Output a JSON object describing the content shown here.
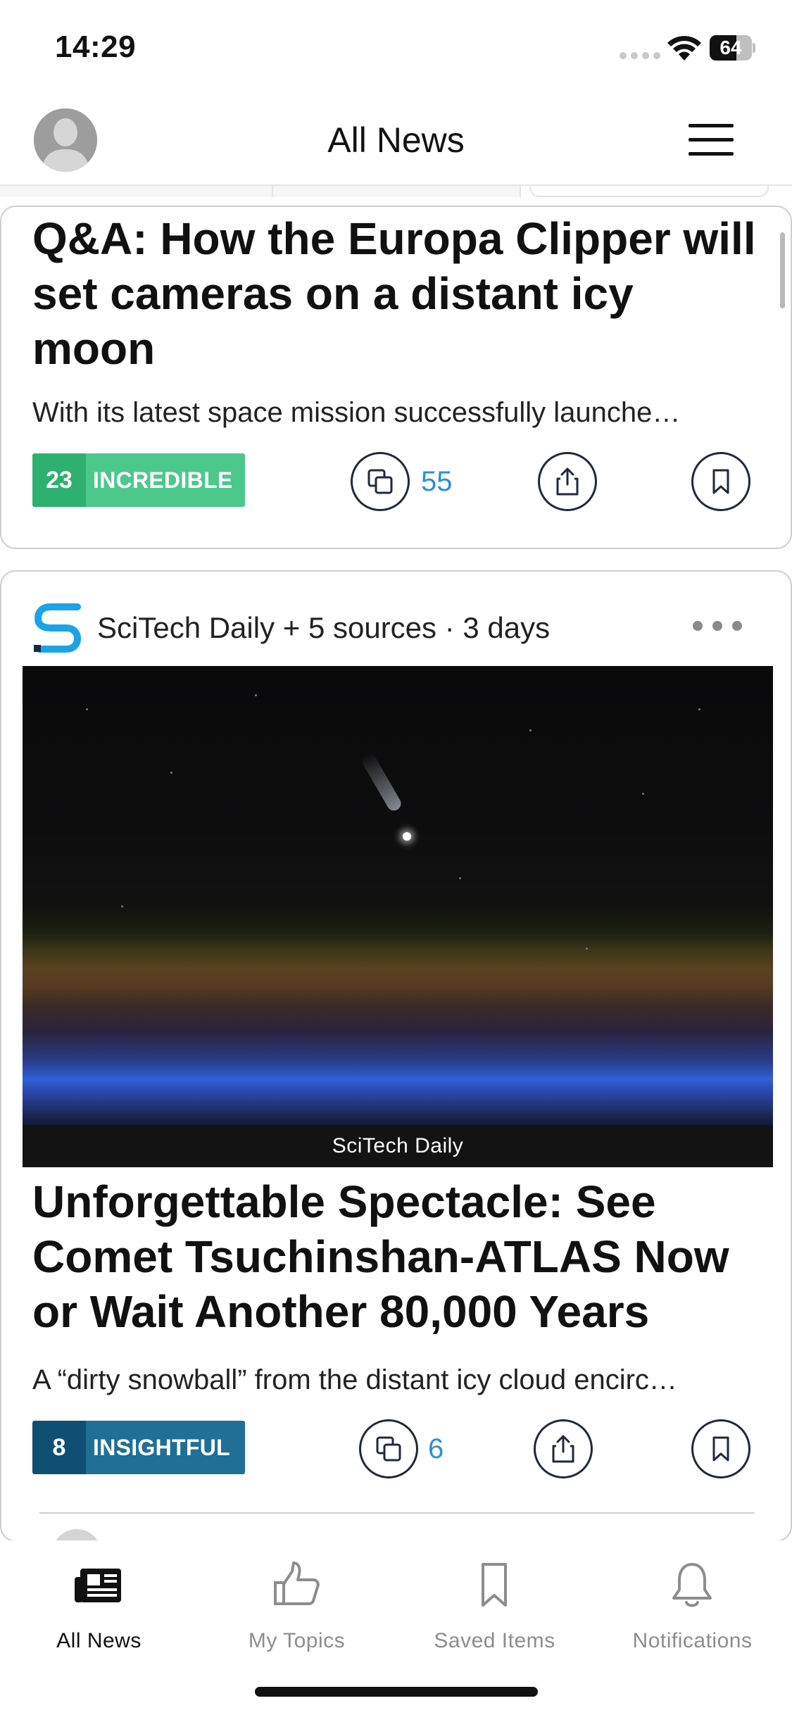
{
  "status_bar": {
    "time": "14:29",
    "battery_level": "64",
    "battery_fraction": 0.64,
    "icons": [
      "signal-dots-icon",
      "wifi-icon",
      "battery-icon"
    ]
  },
  "header": {
    "title": "All News",
    "avatar_icon": "profile-avatar-icon",
    "menu_icon": "hamburger-menu-icon"
  },
  "articles": [
    {
      "headline": "Q&A: How the Europa Clipper will set cameras on a distant icy moon",
      "summary": "With its latest space mission successfully launche…",
      "badge_count": "23",
      "badge_label": "INCREDIBLE",
      "badge_colors": {
        "count_bg": "#2eb06f",
        "label_bg": "#4cc88b"
      },
      "related_count": "55"
    },
    {
      "source": "SciTech Daily + 5 sources · 3 days",
      "source_logo_icon": "scitech-daily-logo-icon",
      "image_caption": "SciTech Daily",
      "headline": "Unforgettable Spectacle: See Comet Tsuchinshan-ATLAS Now or Wait Another 80,000 Years",
      "summary": "A “dirty snowball” from the distant icy cloud encirc…",
      "badge_count": "8",
      "badge_label": "INSIGHTFUL",
      "badge_colors": {
        "count_bg": "#0f4f74",
        "label_bg": "#1f6f97"
      },
      "related_count": "6"
    }
  ],
  "bottom_nav": [
    {
      "label": "All News",
      "icon": "newspaper-icon",
      "active": true
    },
    {
      "label": "My Topics",
      "icon": "thumbs-up-icon",
      "active": false
    },
    {
      "label": "Saved Items",
      "icon": "bookmark-icon",
      "active": false
    },
    {
      "label": "Notifications",
      "icon": "bell-icon",
      "active": false
    }
  ],
  "colors": {
    "link_count": "#2e8fd6",
    "nav_active": "#111111",
    "nav_inactive": "#8d8d8d",
    "logo_blue": "#1aa3e8"
  }
}
